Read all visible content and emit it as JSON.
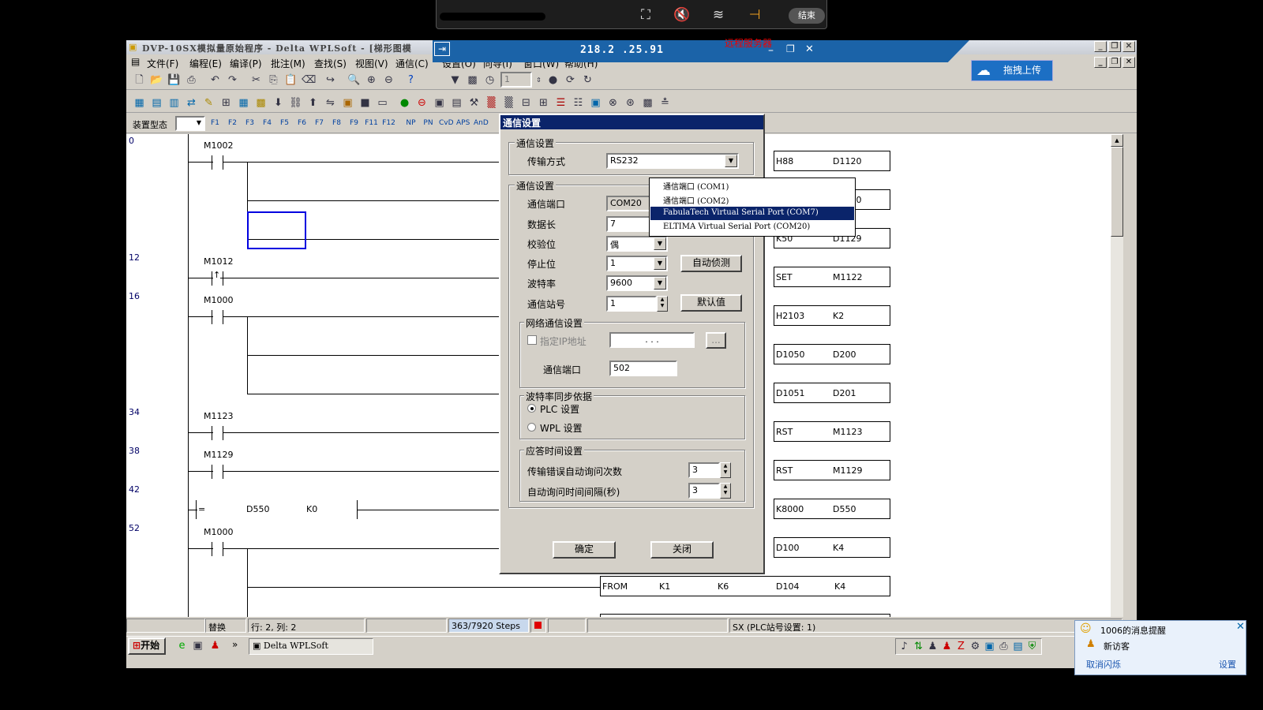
{
  "remote_toolbar": {
    "end_label": "结束"
  },
  "window": {
    "title": "DVP-10SX模拟量原始程序 - Delta WPLSoft - [梯形图模",
    "remote_ip": "218.2  .25.91",
    "remote_server_label": "远程服务器"
  },
  "menu": [
    "文件(F)",
    "编程(E)",
    "编译(P)",
    "批注(M)",
    "查找(S)",
    "视图(V)",
    "通信(C)",
    "设置(O)",
    "向导(I)",
    "窗口(W)",
    "帮助(H)"
  ],
  "toolbar3": {
    "device_label": "装置型态",
    "fkeys": [
      "F1",
      "F2",
      "F3",
      "F4",
      "F5",
      "F6",
      "F7",
      "F8",
      "F9",
      "F11",
      "F12"
    ]
  },
  "upload_button": "拖拽上传",
  "ladder": {
    "steps": [
      "0",
      "12",
      "16",
      "34",
      "38",
      "42",
      "52"
    ],
    "contacts": [
      "M1002",
      "M1012",
      "M1000",
      "M1123",
      "M1129",
      "M1000"
    ],
    "compare": {
      "op": "=",
      "a": "D550",
      "b": "K0"
    },
    "coils": [
      {
        "a": "H88",
        "b": "D1120"
      },
      {
        "a": "",
        "b": "D1120"
      },
      {
        "a": "K50",
        "b": "D1129"
      },
      {
        "a": "SET",
        "b": "M1122"
      },
      {
        "a": "H2103",
        "b": "K2"
      },
      {
        "a": "D1050",
        "b": "D200"
      },
      {
        "a": "D1051",
        "b": "D201"
      },
      {
        "a": "RST",
        "b": "M1123"
      },
      {
        "a": "RST",
        "b": "M1129"
      },
      {
        "a": "K8000",
        "b": "D550"
      },
      {
        "a": "D100",
        "b": "K4"
      }
    ],
    "from_row": {
      "op": "FROM",
      "k1": "K1",
      "k2": "K6",
      "d": "D104",
      "k3": "K4"
    }
  },
  "dialog": {
    "title": "通信设置",
    "group1": "通信设置",
    "transport_label": "传输方式",
    "transport_value": "RS232",
    "group2": "通信设置",
    "port_label": "通信端口",
    "port_value": "COM20",
    "datalen_label": "数据长",
    "datalen_value": "7",
    "parity_label": "校验位",
    "parity_value": "偶",
    "stopbit_label": "停止位",
    "stopbit_value": "1",
    "auto_detect": "自动侦测",
    "baud_label": "波特率",
    "baud_value": "9600",
    "station_label": "通信站号",
    "station_value": "1",
    "default_btn": "默认值",
    "net_group": "网络通信设置",
    "ip_label": "指定IP地址",
    "ip_value": ".   .   .",
    "ip_browse": "...",
    "net_port_label": "通信端口",
    "net_port_value": "502",
    "baud_sync_group": "波特率同步依据",
    "radio_plc": "PLC 设置",
    "radio_wpl": "WPL 设置",
    "resp_group": "应答时间设置",
    "retry_label": "传输错误自动询问次数",
    "retry_value": "3",
    "interval_label": "自动询问时间间隔(秒)",
    "interval_value": "3",
    "ok": "确定",
    "close": "关闭"
  },
  "port_dropdown": [
    "通信端口  (COM1)",
    "通信端口  (COM2)",
    "FabulaTech Virtual Serial Port (COM7)",
    "ELTIMA Virtual Serial Port (COM20)"
  ],
  "statusbar": {
    "mode": "替换",
    "pos": "行: 2, 列: 2",
    "steps": "363/7920 Steps",
    "plc": "SX (PLC站号设置: 1)"
  },
  "taskbar": {
    "start": "开始",
    "arrow": "»",
    "task": "Delta WPLSoft"
  },
  "notification": {
    "title": "1006的消息提醒",
    "body": "新访客",
    "cancel": "取消闪烁",
    "settings": "设置"
  }
}
